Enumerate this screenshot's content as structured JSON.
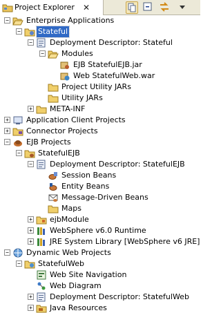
{
  "header": {
    "title": "Project Explorer",
    "close_glyph": "✕",
    "toolbar": [
      "link-editor-icon",
      "collapse-all-icon",
      "sync-icon",
      "view-menu-icon"
    ]
  },
  "tree": [
    {
      "depth": 0,
      "expander": "−",
      "icon": "folder-open-icon",
      "label": "Enterprise Applications"
    },
    {
      "depth": 1,
      "expander": "−",
      "icon": "ear-project-icon",
      "label": "Stateful",
      "selected": true
    },
    {
      "depth": 2,
      "expander": "−",
      "icon": "deployment-descriptor-icon",
      "label": "Deployment Descriptor: Stateful"
    },
    {
      "depth": 3,
      "expander": "−",
      "icon": "folder-open-icon",
      "label": "Modules"
    },
    {
      "depth": 4,
      "expander": "",
      "icon": "ejb-jar-icon",
      "label": "EJB StatefulEJB.jar"
    },
    {
      "depth": 4,
      "expander": "",
      "icon": "web-war-icon",
      "label": "Web StatefulWeb.war"
    },
    {
      "depth": 3,
      "expander": "",
      "icon": "folder-icon",
      "label": "Project Utility JARs"
    },
    {
      "depth": 3,
      "expander": "",
      "icon": "folder-icon",
      "label": "Utility JARs"
    },
    {
      "depth": 2,
      "expander": "+",
      "icon": "folder-icon",
      "label": "META-INF"
    },
    {
      "depth": 0,
      "expander": "+",
      "icon": "app-client-icon",
      "label": "Application Client Projects"
    },
    {
      "depth": 0,
      "expander": "+",
      "icon": "connector-icon",
      "label": "Connector Projects"
    },
    {
      "depth": 0,
      "expander": "−",
      "icon": "ejb-projects-icon",
      "label": "EJB Projects"
    },
    {
      "depth": 1,
      "expander": "−",
      "icon": "ejb-project-icon",
      "label": "StatefulEJB"
    },
    {
      "depth": 2,
      "expander": "−",
      "icon": "deployment-descriptor-icon",
      "label": "Deployment Descriptor: StatefulEJB"
    },
    {
      "depth": 3,
      "expander": "",
      "icon": "session-bean-icon",
      "label": "Session Beans"
    },
    {
      "depth": 3,
      "expander": "",
      "icon": "entity-bean-icon",
      "label": "Entity Beans"
    },
    {
      "depth": 3,
      "expander": "",
      "icon": "mdb-icon",
      "label": "Message-Driven Beans"
    },
    {
      "depth": 3,
      "expander": "",
      "icon": "folder-icon",
      "label": "Maps"
    },
    {
      "depth": 2,
      "expander": "+",
      "icon": "ejb-module-icon",
      "label": "ejbModule"
    },
    {
      "depth": 2,
      "expander": "+",
      "icon": "library-icon",
      "label": "WebSphere v6.0 Runtime"
    },
    {
      "depth": 2,
      "expander": "+",
      "icon": "library-icon",
      "label": "JRE System Library [WebSphere v6 JRE]"
    },
    {
      "depth": 0,
      "expander": "−",
      "icon": "dynamic-web-icon",
      "label": "Dynamic Web Projects"
    },
    {
      "depth": 1,
      "expander": "−",
      "icon": "web-project-icon",
      "label": "StatefulWeb"
    },
    {
      "depth": 2,
      "expander": "",
      "icon": "site-navigation-icon",
      "label": "Web Site Navigation"
    },
    {
      "depth": 2,
      "expander": "",
      "icon": "web-diagram-icon",
      "label": "Web Diagram"
    },
    {
      "depth": 2,
      "expander": "+",
      "icon": "deployment-descriptor-icon",
      "label": "Deployment Descriptor: StatefulWeb"
    },
    {
      "depth": 2,
      "expander": "+",
      "icon": "java-resources-icon",
      "label": "Java Resources"
    }
  ]
}
